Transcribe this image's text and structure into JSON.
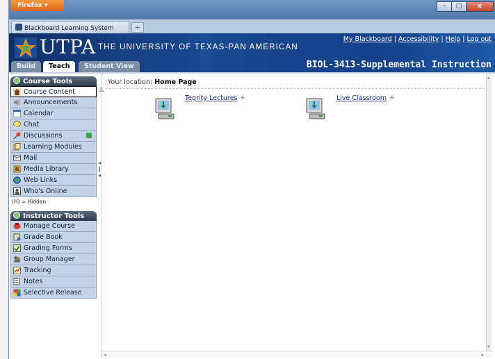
{
  "browser": {
    "app_button": "Firefox",
    "tab_title": "Blackboard Learning System",
    "new_tab": "+",
    "controls": {
      "minimize": "–",
      "maximize": "□",
      "close": "x"
    }
  },
  "header": {
    "logo_text": "UTPA",
    "university_name": "THE UNIVERSITY OF TEXAS-PAN AMERICAN",
    "links": [
      {
        "label": "My Blackboard"
      },
      {
        "label": "Accessibility"
      },
      {
        "label": "Help"
      },
      {
        "label": "Log out"
      }
    ],
    "link_separator": "|",
    "modes": {
      "build": "Build",
      "teach": "Teach",
      "student_view": "Student View"
    },
    "course_title": "BIOL-3413-Supplemental Instruction"
  },
  "sidebar": {
    "course_tools_title": "Course Tools",
    "course_tools": [
      {
        "label": "Course Content",
        "icon": "home-icon"
      },
      {
        "label": "Announcements",
        "icon": "megaphone-icon"
      },
      {
        "label": "Calendar",
        "icon": "calendar-icon"
      },
      {
        "label": "Chat",
        "icon": "chat-bubble-icon"
      },
      {
        "label": "Discussions",
        "icon": "pin-icon"
      },
      {
        "label": "Learning Modules",
        "icon": "module-icon"
      },
      {
        "label": "Mail",
        "icon": "mail-icon"
      },
      {
        "label": "Media Library",
        "icon": "media-library-icon"
      },
      {
        "label": "Web Links",
        "icon": "globe-link-icon"
      },
      {
        "label": "Who's Online",
        "icon": "person-card-icon"
      }
    ],
    "hidden_note": "(H) = Hidden",
    "instructor_tools_title": "Instructor Tools",
    "instructor_tools": [
      {
        "label": "Manage Course",
        "icon": "manage-course-icon"
      },
      {
        "label": "Grade Book",
        "icon": "grade-book-icon"
      },
      {
        "label": "Grading Forms",
        "icon": "grading-forms-icon"
      },
      {
        "label": "Group Manager",
        "icon": "group-icon"
      },
      {
        "label": "Tracking",
        "icon": "chart-icon"
      },
      {
        "label": "Notes",
        "icon": "notes-icon"
      },
      {
        "label": "Selective Release",
        "icon": "selective-release-icon"
      }
    ]
  },
  "main": {
    "location_label": "Your location:",
    "location_value": "Home Page",
    "links": [
      {
        "label": "Tegrity Lectures",
        "icon": "computer-download-icon"
      },
      {
        "label": "Live Classroom",
        "icon": "computer-download-icon"
      }
    ]
  },
  "colors": {
    "header_blue": "#13408a",
    "nav_bg": "#c4d3e8",
    "link_blue": "#1a2d8c",
    "firefox_orange": "#e0621a"
  }
}
